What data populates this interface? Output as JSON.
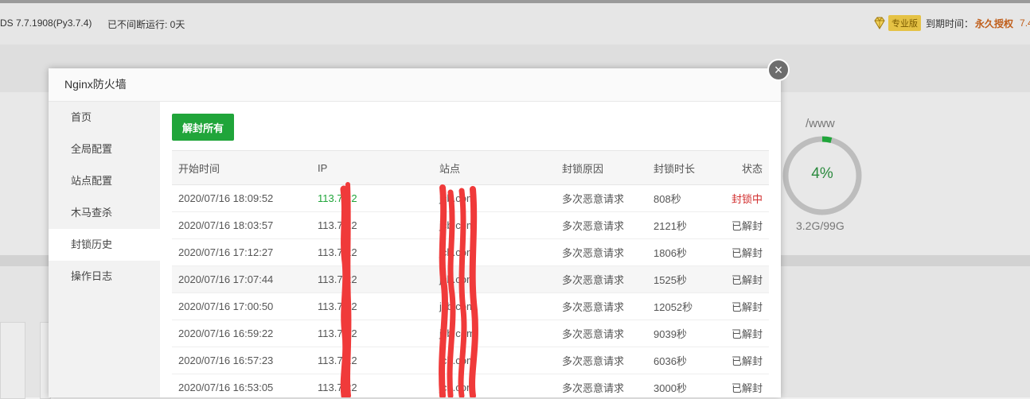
{
  "topbar": {
    "os_text": "DS 7.7.1908(Py3.7.4)",
    "uptime": "已不间断运行: 0天",
    "pro_badge": "专业版",
    "expire_label": "到期时间：",
    "expire_value": "永久授权",
    "version_tail": "7.4"
  },
  "disk": {
    "path": "/www",
    "percent": "4%",
    "percent_value": 4,
    "size": "3.2G/99G"
  },
  "modal": {
    "title": "Nginx防火墙",
    "close_glyph": "×",
    "sidebar": [
      {
        "label": "首页"
      },
      {
        "label": "全局配置"
      },
      {
        "label": "站点配置"
      },
      {
        "label": "木马查杀"
      },
      {
        "label": "封锁历史",
        "active": true
      },
      {
        "label": "操作日志"
      }
    ],
    "unblock_all_label": "解封所有",
    "table": {
      "headers": [
        "开始时间",
        "IP",
        "站点",
        "封锁原因",
        "封锁时长",
        "状态"
      ],
      "rows": [
        {
          "time": "2020/07/16 18:09:52",
          "ip": "113.7.22",
          "site": "jcb.com",
          "reason": "多次恶意请求",
          "duration": "808秒",
          "status": "封锁中"
        },
        {
          "time": "2020/07/16 18:03:57",
          "ip": "113.7.22",
          "site": "jcb.com",
          "reason": "多次恶意请求",
          "duration": "2121秒",
          "status": "已解封"
        },
        {
          "time": "2020/07/16 17:12:27",
          "ip": "113.7.22",
          "site": "jcb.com",
          "reason": "多次恶意请求",
          "duration": "1806秒",
          "status": "已解封"
        },
        {
          "time": "2020/07/16 17:07:44",
          "ip": "113.7.22",
          "site": "jcb.com",
          "reason": "多次恶意请求",
          "duration": "1525秒",
          "status": "已解封"
        },
        {
          "time": "2020/07/16 17:00:50",
          "ip": "113.7.22",
          "site": "jcb.com",
          "reason": "多次恶意请求",
          "duration": "12052秒",
          "status": "已解封"
        },
        {
          "time": "2020/07/16 16:59:22",
          "ip": "113.7.22",
          "site": "jcb.com",
          "reason": "多次恶意请求",
          "duration": "9039秒",
          "status": "已解封"
        },
        {
          "time": "2020/07/16 16:57:23",
          "ip": "113.7.22",
          "site": "jcb.com",
          "reason": "多次恶意请求",
          "duration": "6036秒",
          "status": "已解封"
        },
        {
          "time": "2020/07/16 16:53:05",
          "ip": "113.7.22",
          "site": "jcb.com",
          "reason": "多次恶意请求",
          "duration": "3000秒",
          "status": "已解封"
        }
      ]
    }
  },
  "colors": {
    "accent_green": "#20a53a",
    "blocked_red": "#d22f2f",
    "redaction_red": "#f03a3a"
  }
}
